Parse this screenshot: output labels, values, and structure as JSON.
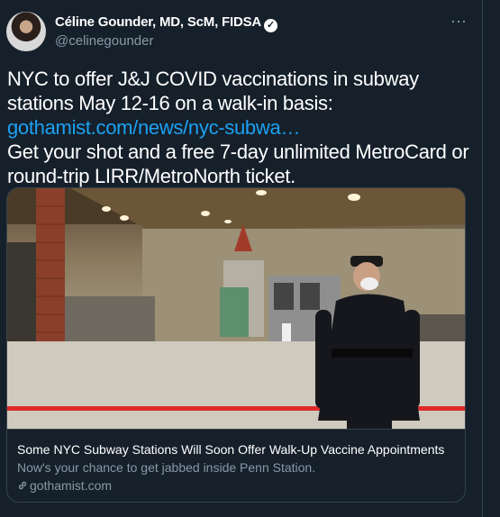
{
  "author": {
    "name": "Céline Gounder, MD, ScM, FIDSA",
    "handle": "@celinegounder"
  },
  "tweet": {
    "line1": "NYC to offer J&J COVID vaccinations in subway stations May 12-16 on a walk-in basis:",
    "link": "gothamist.com/news/nyc-subwa…",
    "line2": "Get your shot and a free 7-day unlimited MetroCard or round-trip LIRR/MetroNorth ticket."
  },
  "card": {
    "title": "Some NYC Subway Stations Will Soon Offer Walk-Up Vaccine Appointments",
    "description": "Now's your chance to get jabbed inside Penn Station.",
    "domain": "gothamist.com"
  },
  "colors": {
    "background": "#15202b",
    "link": "#1da1f2",
    "muted": "#8899a6"
  }
}
